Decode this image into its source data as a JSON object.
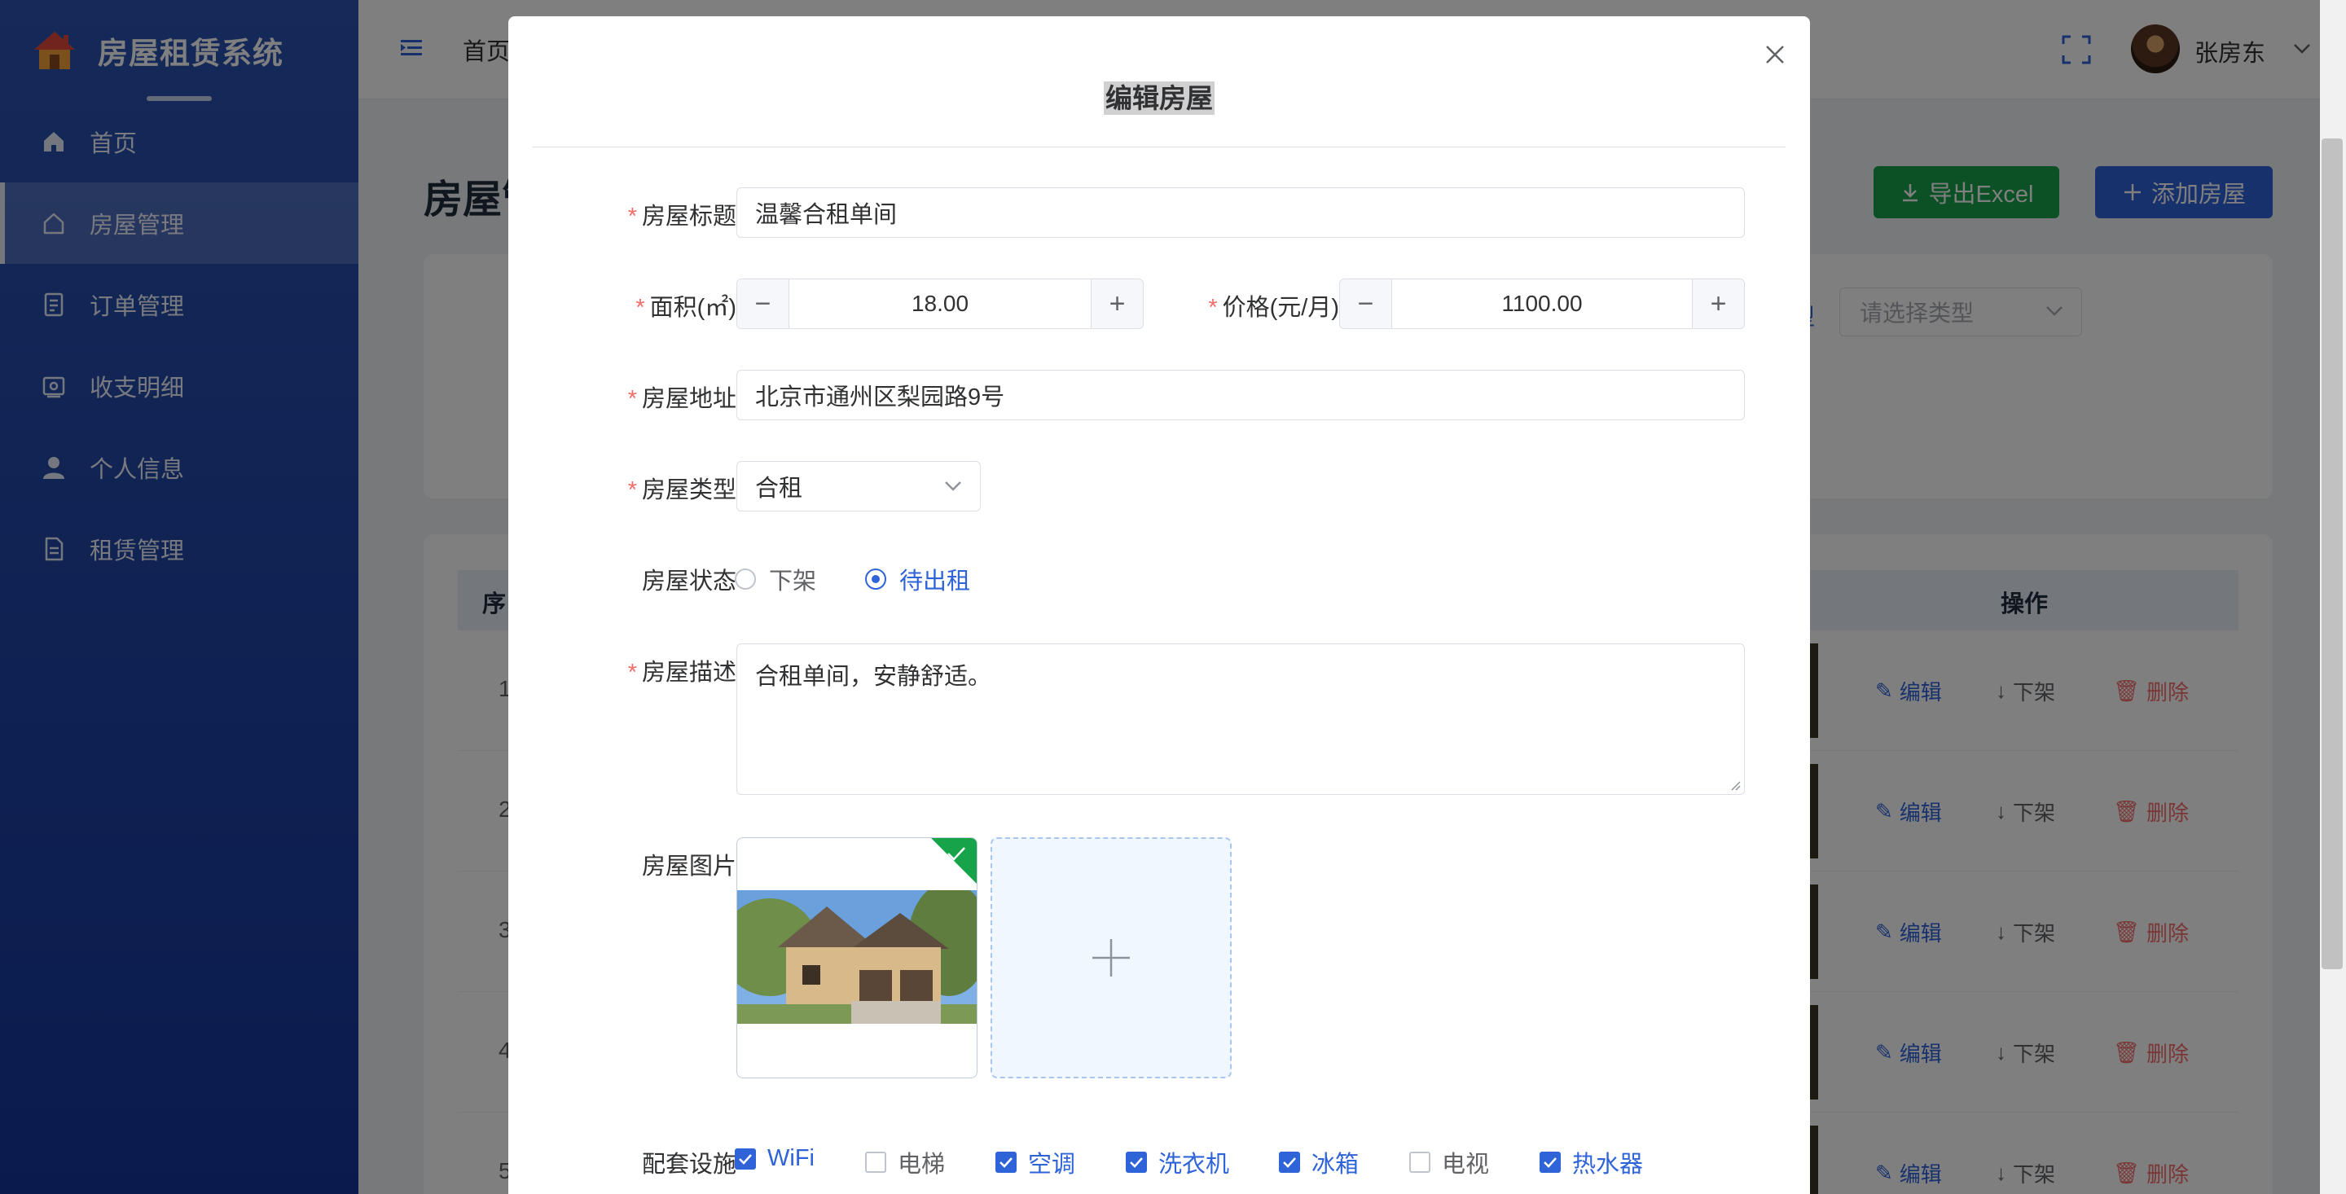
{
  "app": {
    "title": "房屋租赁系统",
    "brand_color": "#2c54b3",
    "accent": "#2f63d8"
  },
  "sidebar": {
    "items": [
      {
        "label": "首页",
        "icon": "home-icon",
        "active": false
      },
      {
        "label": "房屋管理",
        "icon": "house-outline-icon",
        "active": true
      },
      {
        "label": "订单管理",
        "icon": "document-icon",
        "active": false
      },
      {
        "label": "收支明细",
        "icon": "wallet-icon",
        "active": false
      },
      {
        "label": "个人信息",
        "icon": "user-icon",
        "active": false
      },
      {
        "label": "租赁管理",
        "icon": "file-icon",
        "active": false
      }
    ]
  },
  "header": {
    "breadcrumb": "首页",
    "username": "张房东"
  },
  "main": {
    "page_title": "房屋管",
    "export_button": "导出Excel",
    "add_button": "添加房屋",
    "type_filter_label": "型",
    "type_filter_placeholder": "请选择类型",
    "table": {
      "col_seq": "序",
      "col_ops": "操作",
      "rows": [
        {
          "idx": "1",
          "edit": "编辑",
          "down": "下架",
          "delete": "删除"
        },
        {
          "idx": "2",
          "edit": "编辑",
          "down": "下架",
          "delete": "删除"
        },
        {
          "idx": "3",
          "edit": "编辑",
          "down": "下架",
          "delete": "删除"
        },
        {
          "idx": "4",
          "edit": "编辑",
          "down": "下架",
          "delete": "删除"
        },
        {
          "idx": "5",
          "edit": "编辑",
          "down": "下架",
          "delete": "删除"
        }
      ]
    }
  },
  "dialog": {
    "title": "编辑房屋",
    "fields": {
      "title_label": "房屋标题",
      "title_value": "温馨合租单间",
      "area_label": "面积(㎡)",
      "area_value": "18.00",
      "price_label": "价格(元/月)",
      "price_value": "1100.00",
      "address_label": "房屋地址",
      "address_value": "北京市通州区梨园路9号",
      "type_label": "房屋类型",
      "type_value": "合租",
      "status_label": "房屋状态",
      "status_options": [
        {
          "label": "下架",
          "checked": false
        },
        {
          "label": "待出租",
          "checked": true
        }
      ],
      "desc_label": "房屋描述",
      "desc_value": "合租单间，安静舒适。",
      "images_label": "房屋图片",
      "facilities_label": "配套设施",
      "facilities": [
        {
          "label": "WiFi",
          "checked": true
        },
        {
          "label": "电梯",
          "checked": false
        },
        {
          "label": "空调",
          "checked": true
        },
        {
          "label": "洗衣机",
          "checked": true
        },
        {
          "label": "冰箱",
          "checked": true
        },
        {
          "label": "电视",
          "checked": false
        },
        {
          "label": "热水器",
          "checked": true
        }
      ]
    }
  }
}
